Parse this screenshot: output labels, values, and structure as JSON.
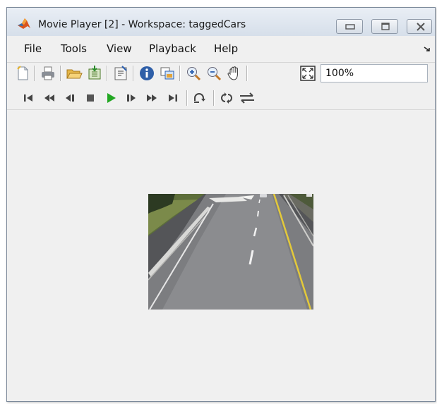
{
  "window": {
    "title": "Movie Player [2] - Workspace: taggedCars",
    "app_icon": "matlab-icon",
    "controls": [
      "minimize-icon",
      "maximize-icon",
      "close-icon"
    ]
  },
  "menu": {
    "items": [
      "File",
      "Tools",
      "View",
      "Playback",
      "Help"
    ],
    "dock_icon": "undock-arrow-icon"
  },
  "toolbar": {
    "zoom_value": "100%",
    "icons": [
      "new-icon",
      "print-icon",
      "open-icon",
      "export-icon",
      "properties-icon",
      "info-icon",
      "copy-frame-icon",
      "zoom-in-icon",
      "zoom-out-icon",
      "pan-hand-icon",
      "fit-to-window-icon"
    ]
  },
  "playback_bar": {
    "icons": [
      "go-to-start-icon",
      "rewind-icon",
      "step-back-icon",
      "stop-icon",
      "play-icon",
      "step-forward-icon",
      "fast-forward-icon",
      "go-to-end-icon",
      "loop-icon",
      "autoreverse-icon",
      "playback-direction-icon"
    ]
  },
  "video": {
    "content": "highway-traffic-frame"
  },
  "colors": {
    "play_green": "#22a722",
    "window_bg": "#f0f0f0"
  }
}
